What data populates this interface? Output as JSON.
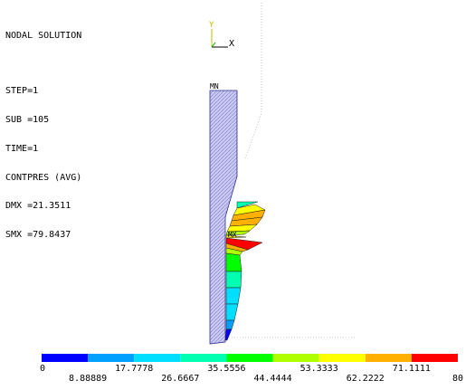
{
  "info": {
    "title": "NODAL SOLUTION",
    "step": "STEP=1",
    "sub": "SUB =105",
    "time": "TIME=1",
    "result": "CONTPRES (AVG)",
    "dmx": "DMX =21.3511",
    "smx": "SMX =79.8437"
  },
  "triad": {
    "y_label": "Y",
    "x_label": "X"
  },
  "markers": {
    "min_label": "MN",
    "max_label": "MX"
  },
  "legend": {
    "colors": [
      "#0000ff",
      "#00a0ff",
      "#00dfff",
      "#00ffb0",
      "#00ff00",
      "#b0ff00",
      "#ffff00",
      "#ffb000",
      "#ff0000"
    ],
    "upper_labels": [
      "0",
      "17.7778",
      "35.5556",
      "53.3333",
      "71.1111"
    ],
    "lower_labels": [
      "8.88889",
      "26.6667",
      "44.4444",
      "62.2222",
      "80"
    ]
  }
}
